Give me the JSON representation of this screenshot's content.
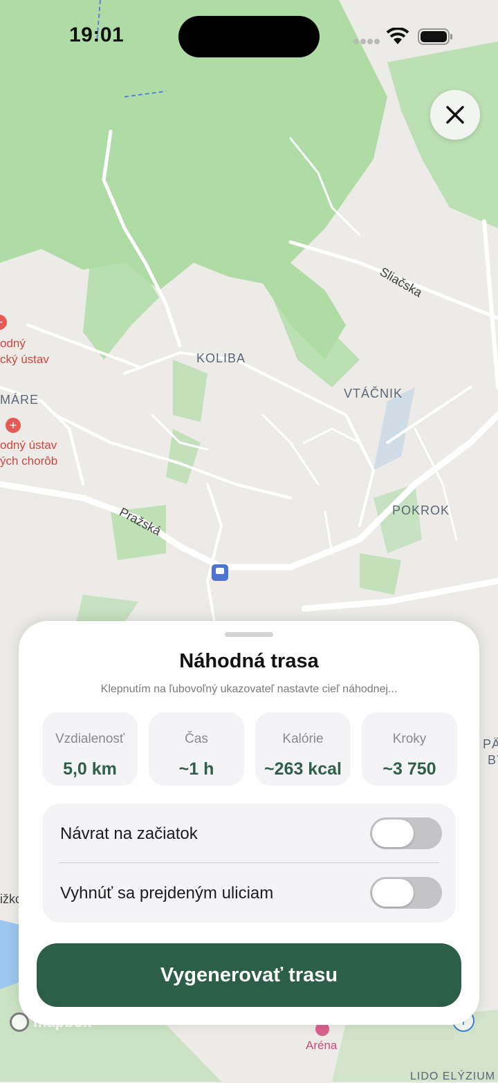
{
  "status_bar": {
    "time": "19:01"
  },
  "map": {
    "labels": {
      "koliba": "KOLIBA",
      "vtacnik": "VTÁČNIK",
      "pokrok": "POKROK",
      "kamare": "MÁRE",
      "sliacska": "Sliačska",
      "prazska": "Pražská",
      "poi1_line1": "odný",
      "poi1_line2": "cký ústav",
      "poi2_line1": "odný ústav",
      "poi2_line2": "ých chorôb",
      "arena": "Aréna",
      "right_edge1": "PÄ",
      "right_edge2": "BY",
      "lido": "LIDO ELÝZIUM",
      "street_edge": "ižko"
    },
    "attribution": "mapbox"
  },
  "sheet": {
    "title": "Náhodná trasa",
    "subtitle": "Klepnutím na ľubovoľný ukazovateľ nastavte cieľ náhodnej...",
    "stats": [
      {
        "label": "Vzdialenosť",
        "value": "5,0 km"
      },
      {
        "label": "Čas",
        "value": "~1 h"
      },
      {
        "label": "Kalórie",
        "value": "~263 kcal"
      },
      {
        "label": "Kroky",
        "value": "~3 750"
      }
    ],
    "options": [
      {
        "label": "Návrat na začiatok",
        "enabled": false
      },
      {
        "label": "Vyhnúť sa prejdeným uliciam",
        "enabled": false
      }
    ],
    "generate_label": "Vygenerovať trasu"
  },
  "colors": {
    "accent": "#2b5f48",
    "forest": "#a8dba0",
    "road": "#ffffff",
    "land": "#ecebe8"
  }
}
